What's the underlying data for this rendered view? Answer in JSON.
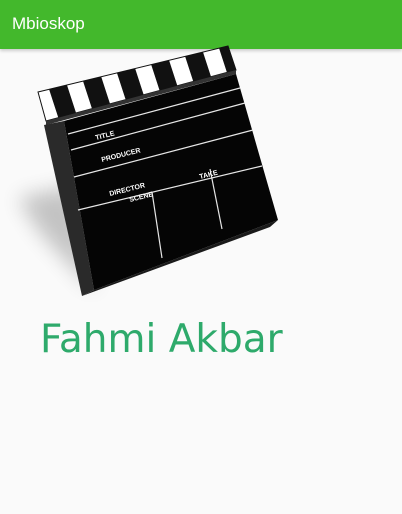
{
  "app_bar": {
    "title": "Mbioskop",
    "color": "#43b82c"
  },
  "clapperboard": {
    "icon": "clapperboard-icon",
    "labels": {
      "title": "TITLE",
      "producer": "PRODUCER",
      "director": "DIRECTOR",
      "scene": "SCENE",
      "take": "TAKE"
    }
  },
  "profile": {
    "name": "Fahmi Akbar",
    "name_color": "#2eaa6b"
  }
}
